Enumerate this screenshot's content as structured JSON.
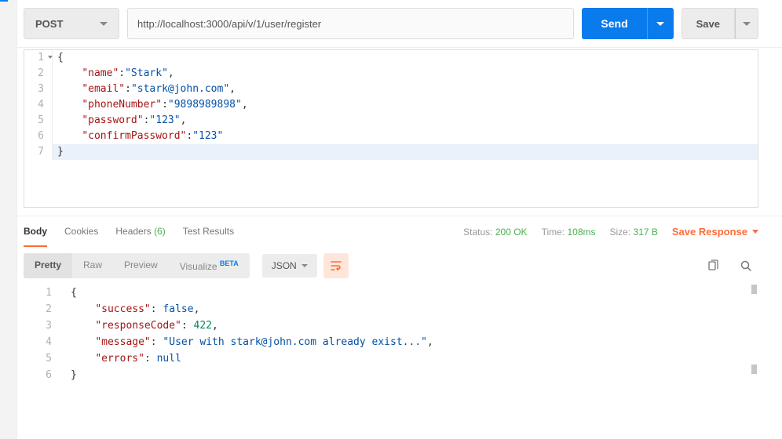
{
  "request": {
    "method": "POST",
    "url": "http://localhost:3000/api/v/1/user/register",
    "send_label": "Send",
    "save_label": "Save"
  },
  "request_body": {
    "lines": [
      {
        "n": "1",
        "indent": "",
        "content": "{"
      },
      {
        "n": "2",
        "indent": "    ",
        "k": "\"name\"",
        "v": "\"Stark\"",
        "c": ","
      },
      {
        "n": "3",
        "indent": "    ",
        "k": "\"email\"",
        "v": "\"stark@john.com\"",
        "c": ","
      },
      {
        "n": "4",
        "indent": "    ",
        "k": "\"phoneNumber\"",
        "v": "\"9898989898\"",
        "c": ","
      },
      {
        "n": "5",
        "indent": "    ",
        "k": "\"password\"",
        "v": "\"123\"",
        "c": ","
      },
      {
        "n": "6",
        "indent": "    ",
        "k": "\"confirmPassword\"",
        "v": "\"123\"",
        "c": ""
      },
      {
        "n": "7",
        "indent": "",
        "content": "}"
      }
    ]
  },
  "response_header": {
    "tabs": {
      "body": "Body",
      "cookies": "Cookies",
      "headers": "Headers",
      "headers_count": "(6)",
      "test_results": "Test Results"
    },
    "status_label": "Status:",
    "status_value": "200 OK",
    "time_label": "Time:",
    "time_value": "108ms",
    "size_label": "Size:",
    "size_value": "317 B",
    "save_response": "Save Response"
  },
  "response_toolbar": {
    "pretty": "Pretty",
    "raw": "Raw",
    "preview": "Preview",
    "visualize": "Visualize",
    "beta": "BETA",
    "format": "JSON"
  },
  "response_body": {
    "lines": [
      {
        "n": "1",
        "indent": "",
        "content": "{"
      },
      {
        "n": "2",
        "indent": "    ",
        "k": "\"success\"",
        "v": "false",
        "t": "bool",
        "c": ","
      },
      {
        "n": "3",
        "indent": "    ",
        "k": "\"responseCode\"",
        "v": "422",
        "t": "num",
        "c": ","
      },
      {
        "n": "4",
        "indent": "    ",
        "k": "\"message\"",
        "v": "\"User with stark@john.com already exist...\"",
        "t": "str",
        "c": ","
      },
      {
        "n": "5",
        "indent": "    ",
        "k": "\"errors\"",
        "v": "null",
        "t": "null",
        "c": ""
      },
      {
        "n": "6",
        "indent": "",
        "content": "}"
      }
    ]
  }
}
